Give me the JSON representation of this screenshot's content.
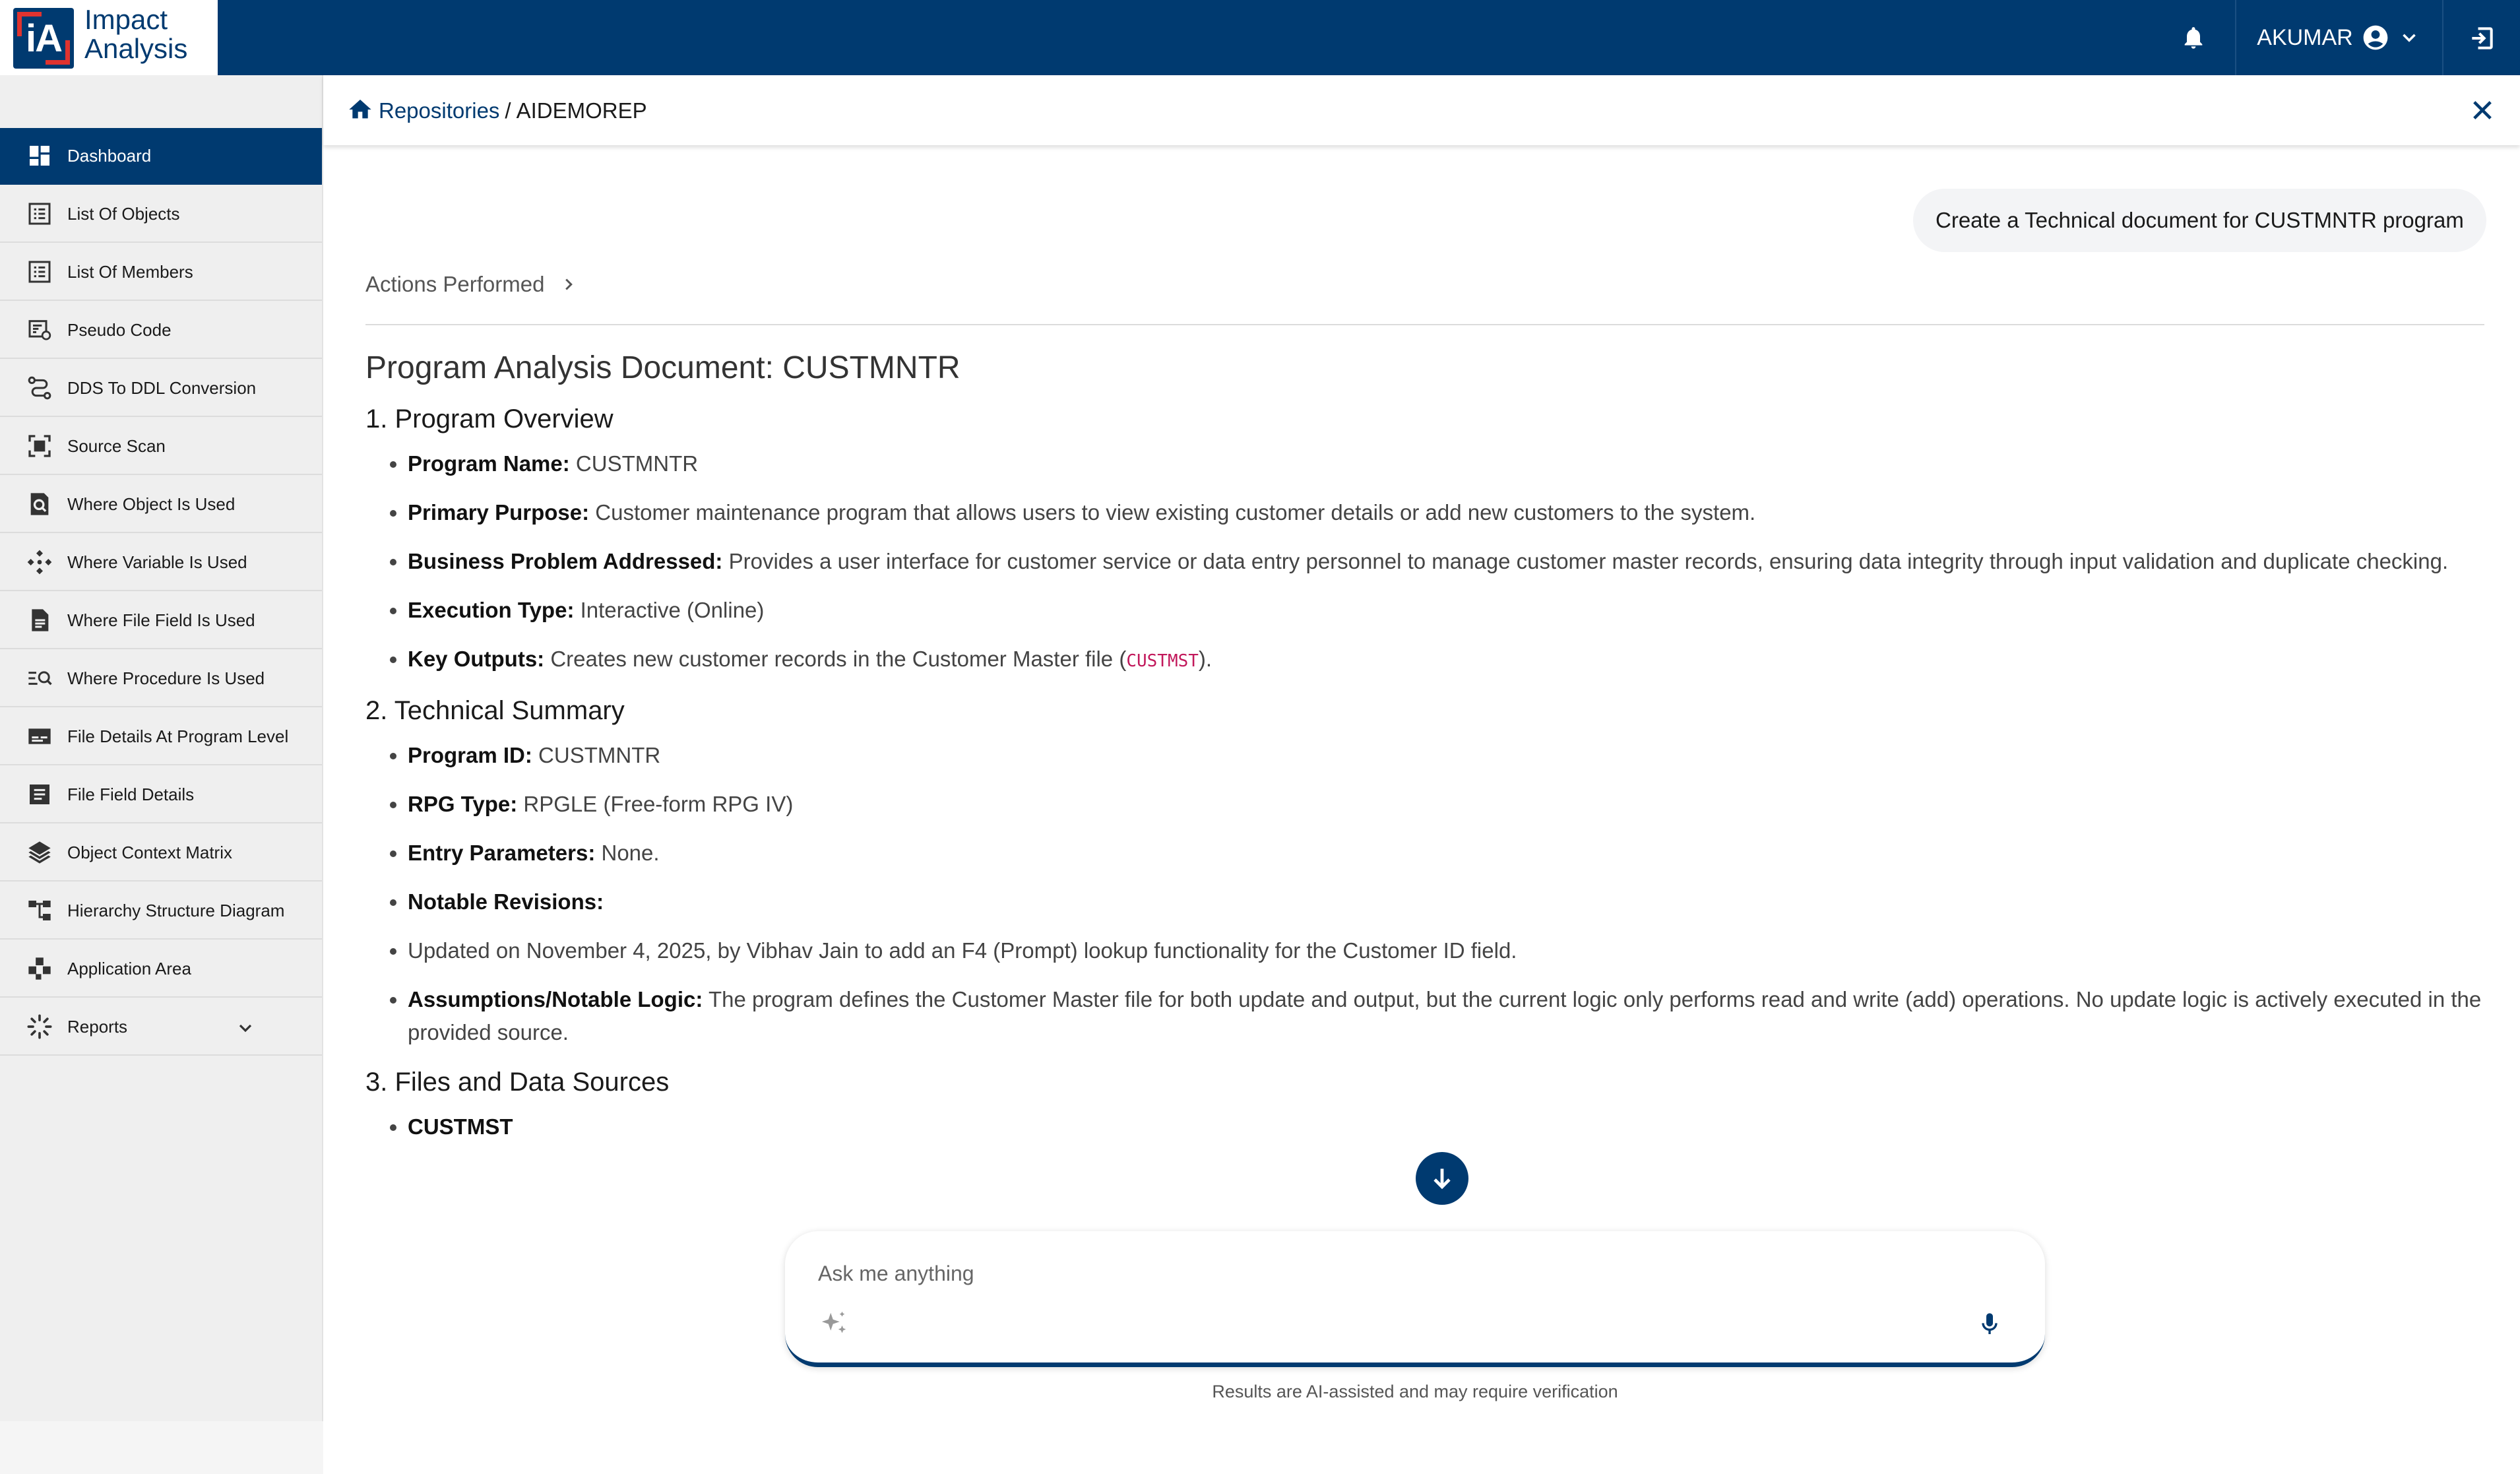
{
  "app": {
    "logo_letters": "iA",
    "logo_line1": "Impact",
    "logo_line2": "Analysis",
    "user": "AKUMAR"
  },
  "colors": {
    "primary": "#003a70",
    "accent": "#e0332f",
    "code": "#c2185b"
  },
  "sidebar": {
    "items": [
      {
        "label": "Dashboard",
        "icon": "dashboard-icon"
      },
      {
        "label": "List Of Objects",
        "icon": "list-icon"
      },
      {
        "label": "List Of Members",
        "icon": "list-icon"
      },
      {
        "label": "Pseudo Code",
        "icon": "pseudo-code-icon"
      },
      {
        "label": "DDS To DDL Conversion",
        "icon": "conversion-icon"
      },
      {
        "label": "Source Scan",
        "icon": "scan-icon"
      },
      {
        "label": "Where Object Is Used",
        "icon": "search-document-icon"
      },
      {
        "label": "Where Variable Is Used",
        "icon": "variable-icon"
      },
      {
        "label": "Where File Field Is Used",
        "icon": "file-icon"
      },
      {
        "label": "Where Procedure Is Used",
        "icon": "procedure-search-icon"
      },
      {
        "label": "File Details At Program Level",
        "icon": "file-details-icon"
      },
      {
        "label": "File Field Details",
        "icon": "field-details-icon"
      },
      {
        "label": "Object Context Matrix",
        "icon": "layers-icon"
      },
      {
        "label": "Hierarchy Structure Diagram",
        "icon": "hierarchy-icon"
      },
      {
        "label": "Application Area",
        "icon": "application-area-icon"
      },
      {
        "label": "Reports",
        "icon": "reports-icon"
      }
    ]
  },
  "breadcrumb": {
    "root": "Repositories",
    "separator": "/",
    "current": "AIDEMOREP"
  },
  "chat": {
    "user_prompt": "Create a Technical document for CUSTMNTR program",
    "actions_label": "Actions Performed"
  },
  "doc": {
    "title": "Program Analysis Document: CUSTMNTR",
    "s1_heading": "1. Program Overview",
    "s1": {
      "name_label": "Program Name:",
      "name_value": "CUSTMNTR",
      "purpose_label": "Primary Purpose:",
      "purpose_value": "Customer maintenance program that allows users to view existing customer details or add new customers to the system.",
      "problem_label": "Business Problem Addressed:",
      "problem_value": "Provides a user interface for customer service or data entry personnel to manage customer master records, ensuring data integrity through input validation and duplicate checking.",
      "exec_label": "Execution Type:",
      "exec_value": "Interactive (Online)",
      "outputs_label": "Key Outputs:",
      "outputs_value_pre": "Creates new customer records in the Customer Master file (",
      "outputs_code": "CUSTMST",
      "outputs_value_post": ")."
    },
    "s2_heading": "2. Technical Summary",
    "s2": {
      "id_label": "Program ID:",
      "id_value": "CUSTMNTR",
      "rpg_label": "RPG Type:",
      "rpg_value": "RPGLE (Free-form RPG IV)",
      "params_label": "Entry Parameters:",
      "params_value": "None.",
      "revisions_label": "Notable Revisions:",
      "revision_text": "Updated on November 4, 2025, by Vibhav Jain to add an F4 (Prompt) lookup functionality for the Customer ID field.",
      "assump_label": "Assumptions/Notable Logic:",
      "assump_value": "The program defines the Customer Master file for both update and output, but the current logic only performs read and write (add) operations. No update logic is actively executed in the provided source."
    },
    "s3_heading": "3. Files and Data Sources",
    "s3_first_item": "CUSTMST"
  },
  "input": {
    "placeholder": "Ask me anything"
  },
  "footer": {
    "disclaimer": "Results are AI-assisted and may require verification"
  }
}
